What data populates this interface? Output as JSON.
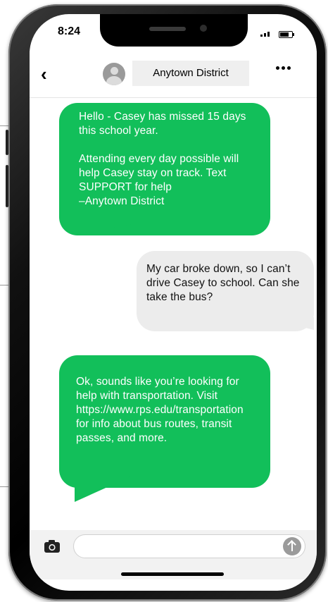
{
  "status": {
    "time": "8:24"
  },
  "header": {
    "contact_name": "Anytown District"
  },
  "messages": [
    {
      "direction": "incoming",
      "text": "Hello - Casey has missed 15 days this school year.\n\nAttending every day possible will help Casey stay on track. Text SUPPORT for help\n–Anytown District"
    },
    {
      "direction": "outgoing",
      "text": "My car broke down, so I can’t drive Casey to school. Can she take the bus?"
    },
    {
      "direction": "incoming",
      "text": "Ok, sounds like you’re looking for help with transportation. Visit https://www.rps.edu/transportation for info about bus routes, transit passes, and more."
    }
  ],
  "composer": {
    "placeholder": ""
  },
  "colors": {
    "incoming_bubble": "#12bf5a",
    "outgoing_bubble": "#ececec"
  },
  "icons": {
    "back": "chevron-left-icon",
    "menu": "more-dots-icon",
    "camera": "camera-icon",
    "send": "send-arrow-icon"
  }
}
